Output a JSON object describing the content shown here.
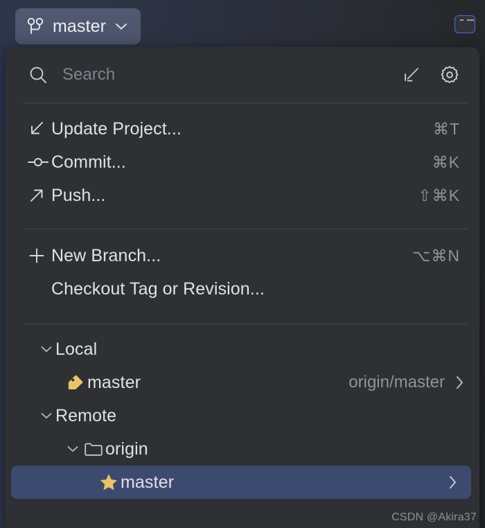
{
  "branch_button": {
    "icon": "git-branch-icon",
    "label": "master",
    "dropdown_icon": "chevron-down-icon"
  },
  "toolbar": {
    "terminal_toggle_icon": "terminal-icon"
  },
  "popup": {
    "search": {
      "icon": "search-icon",
      "placeholder": "Search",
      "value": "",
      "actions": [
        {
          "icon": "update-project-icon",
          "name": "expand-collapse-icon"
        },
        {
          "icon": "gear-icon",
          "name": "settings-icon"
        }
      ]
    },
    "actions_primary": [
      {
        "icon": "arrow-down-left-icon",
        "label": "Update Project...",
        "shortcut": "⌘T"
      },
      {
        "icon": "commit-icon",
        "label": "Commit...",
        "shortcut": "⌘K"
      },
      {
        "icon": "arrow-up-right-icon",
        "label": "Push...",
        "shortcut": "⇧⌘K"
      }
    ],
    "actions_secondary": [
      {
        "icon": "plus-icon",
        "label": "New Branch...",
        "shortcut": "⌥⌘N"
      },
      {
        "icon": "",
        "label": "Checkout Tag or Revision...",
        "shortcut": ""
      }
    ],
    "tree": {
      "local": {
        "label": "Local",
        "chevron": "chevron-down-icon",
        "branches": [
          {
            "icon": "tag-icon",
            "name": "master",
            "tracking": "origin/master",
            "arrow": "chevron-right-icon",
            "selected": false
          }
        ]
      },
      "remote": {
        "label": "Remote",
        "chevron": "chevron-down-icon",
        "groups": [
          {
            "icon": "folder-icon",
            "label": "origin",
            "chevron": "chevron-down-icon",
            "branches": [
              {
                "icon": "star-icon",
                "name": "master",
                "tracking": "",
                "arrow": "chevron-right-icon",
                "selected": true
              }
            ]
          }
        ]
      }
    }
  },
  "watermark": "CSDN @Akira37",
  "colors": {
    "panel_bg": "#2e3033",
    "backdrop_left": "#2d354b",
    "backdrop_right": "#232428",
    "selection": "#3c4a70",
    "button_bg": "#4f5770",
    "accent_gold": "#e9c46a",
    "text_primary": "#dfe2e6",
    "text_muted": "#8e949d",
    "terminal_border": "#4a6ecb"
  }
}
